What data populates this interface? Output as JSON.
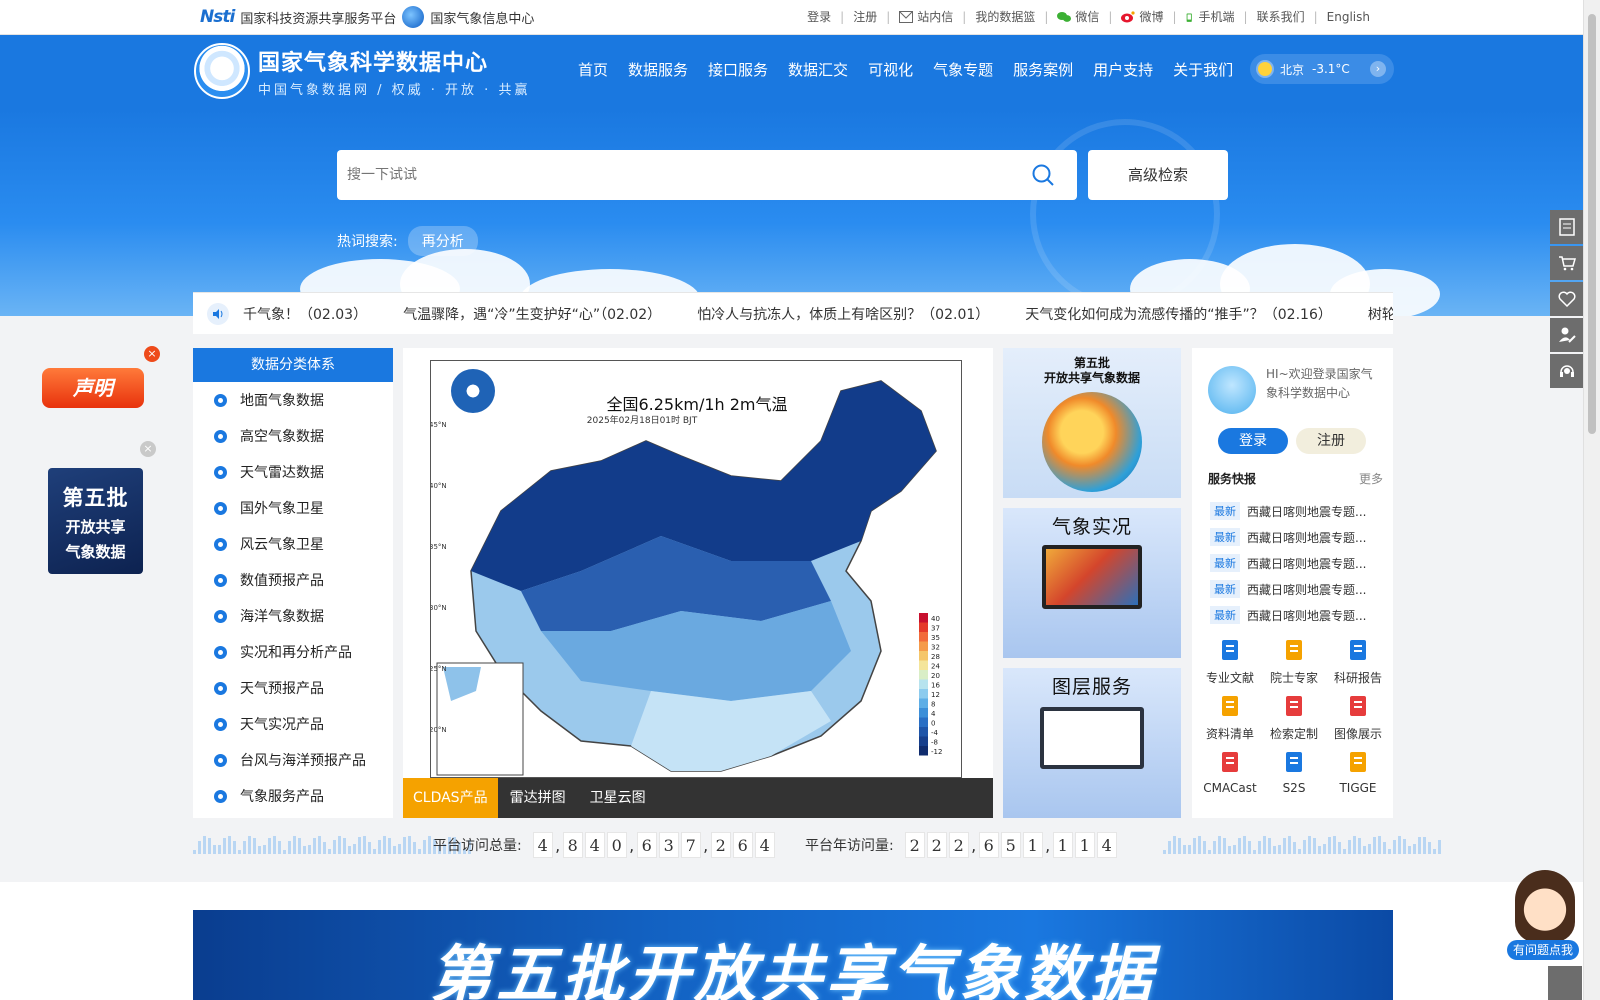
{
  "topbar": {
    "nsti_logo": "Nsti",
    "platform1": "国家科技资源共享服务平台",
    "platform2": "国家气象信息中心",
    "links": [
      "登录",
      "注册",
      "站内信",
      "我的数据篮",
      "微信",
      "微博",
      "手机端",
      "联系我们",
      "English"
    ]
  },
  "header": {
    "title": "国家气象科学数据中心",
    "subtitle": "中国气象数据网 / 权威 · 开放 · 共赢",
    "nav": [
      "首页",
      "数据服务",
      "接口服务",
      "数据汇交",
      "可视化",
      "气象专题",
      "服务案例",
      "用户支持",
      "关于我们"
    ],
    "weather_city": "北京",
    "weather_temp": "-3.1°C"
  },
  "search": {
    "placeholder": "搜一下试试",
    "advanced_label": "高级检索",
    "hot_label": "热词搜索:",
    "hot_tags": [
      "再分析"
    ]
  },
  "ticker": {
    "items": [
      "千气象！（02.03）",
      "气温骤降，遇“冷”生变护好“心”（02.02）",
      "怕冷人与抗冻人，体质上有啥区别？（02.01）",
      "天气变化如何成为流感传播的“推手”？（02.16）",
      "树轮中的"
    ]
  },
  "category": {
    "title": "数据分类体系",
    "items": [
      "地面气象数据",
      "高空气象数据",
      "天气雷达数据",
      "国外气象卫星",
      "风云气象卫星",
      "数值预报产品",
      "海洋气象数据",
      "实况和再分析产品",
      "天气预报产品",
      "天气实况产品",
      "台风与海洋预报产品",
      "气象服务产品"
    ]
  },
  "map": {
    "title": "全国6.25km/1h 2m气温",
    "subtitle": "2025年02月18日01时 BJT",
    "lat_labels": [
      "45°N",
      "40°N",
      "35°N",
      "30°N",
      "25°N",
      "20°N"
    ],
    "legend_ticks": [
      "40",
      "37",
      "35",
      "32",
      "28",
      "24",
      "20",
      "16",
      "12",
      "8",
      "4",
      "0",
      "-4",
      "-8",
      "-12"
    ],
    "tabs": [
      "CLDAS产品",
      "雷达拼图",
      "卫星云图"
    ],
    "active_tab": "CLDAS产品"
  },
  "promos": [
    {
      "caption_line1": "第五批",
      "caption_line2": "开放共享气象数据"
    },
    {
      "caption": "气象实况"
    },
    {
      "caption": "图层服务"
    }
  ],
  "user": {
    "welcome": "HI~欢迎登录国家气象科学数据中心",
    "login": "登录",
    "register": "注册",
    "news_title": "服务快报",
    "news_more": "更多",
    "news_badge": "最新",
    "news": [
      "西藏日喀则地震专题...",
      "西藏日喀则地震专题...",
      "西藏日喀则地震专题...",
      "西藏日喀则地震专题...",
      "西藏日喀则地震专题..."
    ],
    "services": [
      {
        "label": "专业文献",
        "icon": "book-icon",
        "color": "#1a78e0"
      },
      {
        "label": "院士专家",
        "icon": "expert-icon",
        "color": "#f5a200"
      },
      {
        "label": "科研报告",
        "icon": "document-icon",
        "color": "#1a78e0"
      },
      {
        "label": "资料清单",
        "icon": "folder-icon",
        "color": "#f5a200"
      },
      {
        "label": "检索定制",
        "icon": "search-custom-icon",
        "color": "#e63c3c"
      },
      {
        "label": "图像展示",
        "icon": "image-icon",
        "color": "#e63c3c"
      },
      {
        "label": "CMACast",
        "icon": "satellite-dish-icon",
        "color": "#e63c3c"
      },
      {
        "label": "S2S",
        "icon": "s2s-icon",
        "color": "#1a78e0"
      },
      {
        "label": "TIGGE",
        "icon": "tigge-icon",
        "color": "#f5a200"
      }
    ]
  },
  "counters": {
    "total_label": "平台访问总量:",
    "total_digits": [
      "4",
      ",",
      "8",
      "4",
      "0",
      ",",
      "6",
      "3",
      "7",
      ",",
      "2",
      "6",
      "4"
    ],
    "year_label": "平台年访问量:",
    "year_digits": [
      "2",
      "2",
      "2",
      ",",
      "6",
      "5",
      "1",
      ",",
      "1",
      "1",
      "4"
    ]
  },
  "bottom_banner": {
    "text": "第五批开放共享气象数据"
  },
  "floaters": {
    "statement": "声明",
    "batch_line1": "第五批",
    "batch_line2": "开放共享",
    "batch_line3": "气象数据",
    "close": "×",
    "helper": "有问题点我"
  },
  "colors": {
    "primary": "#1a78e0",
    "accent": "#f5a200",
    "danger": "#e8320c"
  }
}
